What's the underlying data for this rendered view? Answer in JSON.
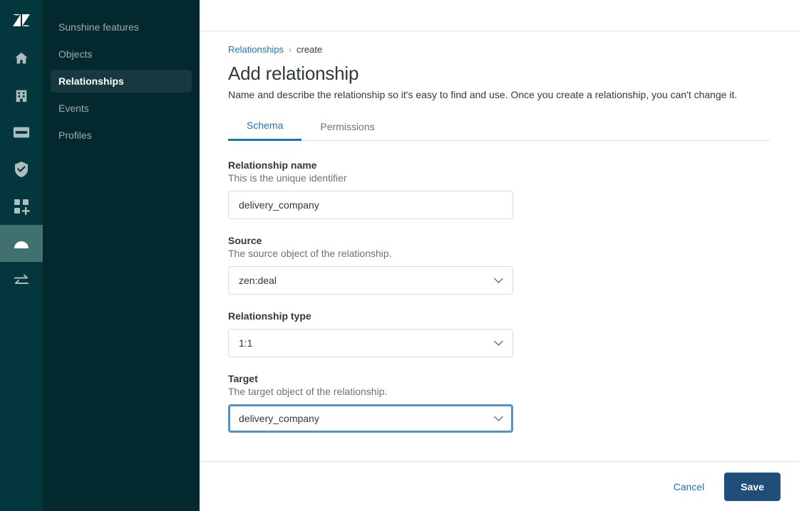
{
  "colors": {
    "rail_bg": "#03363d",
    "rail_active": "#40706f",
    "nav_bg": "#03282e",
    "nav_active_bg": "#17383e",
    "accent_blue": "#1f73b7",
    "save_button_bg": "#1f4f78",
    "focus_border": "#5293c7",
    "text_primary": "#2f3941",
    "text_muted": "#68737d",
    "border": "#d8dcde"
  },
  "rail": {
    "logo": {
      "name": "zendesk-logo-icon"
    },
    "items": [
      {
        "name": "home-icon",
        "active": false
      },
      {
        "name": "organizations-icon",
        "active": false
      },
      {
        "name": "card-icon",
        "active": false
      },
      {
        "name": "shield-check-icon",
        "active": false
      },
      {
        "name": "apps-add-icon",
        "active": false
      },
      {
        "name": "sunshine-cloud-icon",
        "active": true
      },
      {
        "name": "transfer-arrows-icon",
        "active": false
      }
    ]
  },
  "sidebar": {
    "items": [
      {
        "label": "Sunshine features",
        "active": false
      },
      {
        "label": "Objects",
        "active": false
      },
      {
        "label": "Relationships",
        "active": true
      },
      {
        "label": "Events",
        "active": false
      },
      {
        "label": "Profiles",
        "active": false
      }
    ]
  },
  "breadcrumb": {
    "parent": "Relationships",
    "separator": "›",
    "current": "create"
  },
  "header": {
    "title": "Add relationship",
    "description": "Name and describe the relationship so it's easy to find and use. Once you create a relationship, you can't change it."
  },
  "tabs": [
    {
      "label": "Schema",
      "active": true
    },
    {
      "label": "Permissions",
      "active": false
    }
  ],
  "form": {
    "fields": [
      {
        "label": "Relationship name",
        "hint": "This is the unique identifier",
        "type": "text",
        "value": "delivery_company",
        "placeholder": "",
        "focused": false
      },
      {
        "label": "Source",
        "hint": "The source object of the relationship.",
        "type": "select",
        "value": "zen:deal",
        "focused": false
      },
      {
        "label": "Relationship type",
        "hint": "",
        "type": "select",
        "value": "1:1",
        "focused": false
      },
      {
        "label": "Target",
        "hint": "The target object of the relationship.",
        "type": "select",
        "value": "delivery_company",
        "focused": true
      }
    ]
  },
  "footer": {
    "cancel_label": "Cancel",
    "save_label": "Save"
  }
}
